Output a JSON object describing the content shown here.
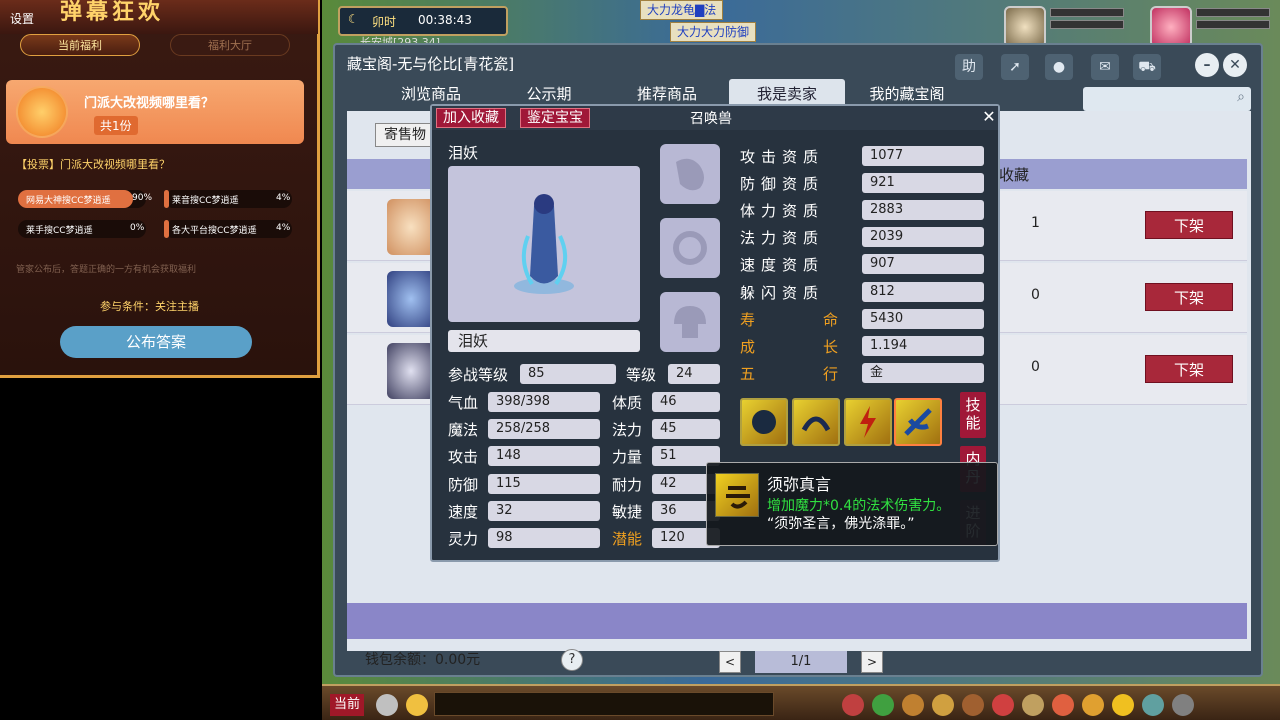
{
  "left_panel": {
    "settings": "设置",
    "banner": "弹幕狂欢",
    "tab_current": "当前福利",
    "tab_hall": "福利大厅",
    "card_title": "门派大改视频哪里看？",
    "card_count": "共1份",
    "vote_title": "【投票】门派大改视频哪里看？",
    "votes": [
      {
        "label": "网易大神搜CC梦逍遥",
        "pct": "90%",
        "fill": 0.9
      },
      {
        "label": "莱音搜CC梦逍遥",
        "pct": "4%",
        "fill": 0.04
      },
      {
        "label": "莱手搜CC梦逍遥",
        "pct": "0%",
        "fill": 0.0
      },
      {
        "label": "各大平台搜CC梦逍遥",
        "pct": "4%",
        "fill": 0.04
      }
    ],
    "note": "管家公布后，答题正确的一方有机会获取福利",
    "condition": "参与条件：关注主播",
    "answer_btn": "公布答案"
  },
  "hud": {
    "time_label": "卯时",
    "clock": "00:38:43",
    "coords": "长安城[293,34]",
    "buff1": "大力龙龟▇法",
    "buff2": "大力大力防御"
  },
  "window": {
    "title": "藏宝阁-无与伦比[青花瓷]",
    "tabs": [
      "浏览商品",
      "公示期",
      "推荐商品",
      "我是卖家",
      "我的藏宝阁"
    ],
    "active_tab": 3,
    "btn_help": "助",
    "sell_label": "寄售物品",
    "col_fav": "收藏",
    "rows": [
      {
        "fav": "1",
        "action": "下架"
      },
      {
        "fav": "0",
        "action": "下架"
      },
      {
        "fav": "0",
        "action": "下架"
      }
    ],
    "wallet": "钱包余额：0.00元",
    "help": "?",
    "prev": "<",
    "next": ">",
    "page": "1/1"
  },
  "pet": {
    "btn_fav": "加入收藏",
    "btn_appraise": "鉴定宝宝",
    "title": "召唤兽",
    "close": "✕",
    "name": "泪妖",
    "name_field": "泪妖",
    "level_label": "参战等级",
    "level_val": "85",
    "grade_label": "等级",
    "grade_val": "24",
    "stats_left": [
      {
        "label": "气血",
        "val": "398/398"
      },
      {
        "label": "魔法",
        "val": "258/258"
      },
      {
        "label": "攻击",
        "val": "148"
      },
      {
        "label": "防御",
        "val": "115"
      },
      {
        "label": "速度",
        "val": "32"
      },
      {
        "label": "灵力",
        "val": "98"
      }
    ],
    "stats_right": [
      {
        "label": "体质",
        "val": "46",
        "orange": false
      },
      {
        "label": "法力",
        "val": "45",
        "orange": false
      },
      {
        "label": "力量",
        "val": "51",
        "orange": false
      },
      {
        "label": "耐力",
        "val": "42",
        "orange": false
      },
      {
        "label": "敏捷",
        "val": "36",
        "orange": false
      },
      {
        "label": "潜能",
        "val": "120",
        "orange": true
      }
    ],
    "aptitudes": [
      {
        "label": "攻击资质",
        "val": "1077",
        "orange": false
      },
      {
        "label": "防御资质",
        "val": "921",
        "orange": false
      },
      {
        "label": "体力资质",
        "val": "2883",
        "orange": false
      },
      {
        "label": "法力资质",
        "val": "2039",
        "orange": false
      },
      {
        "label": "速度资质",
        "val": "907",
        "orange": false
      },
      {
        "label": "躲闪资质",
        "val": "812",
        "orange": false
      },
      {
        "label": "寿命",
        "val": "5430",
        "orange": true
      },
      {
        "label": "成长",
        "val": "1.194",
        "orange": true
      },
      {
        "label": "五行",
        "val": "金",
        "orange": true
      }
    ],
    "side_tabs": [
      "技能",
      "内丹",
      "进阶"
    ],
    "tooltip": {
      "name": "须弥真言",
      "desc": "增加魔力*0.4的法术伤害力。",
      "quote": "“须弥圣言，佛光涤罪。”"
    }
  },
  "bottom_bar": {
    "current": "当前"
  }
}
